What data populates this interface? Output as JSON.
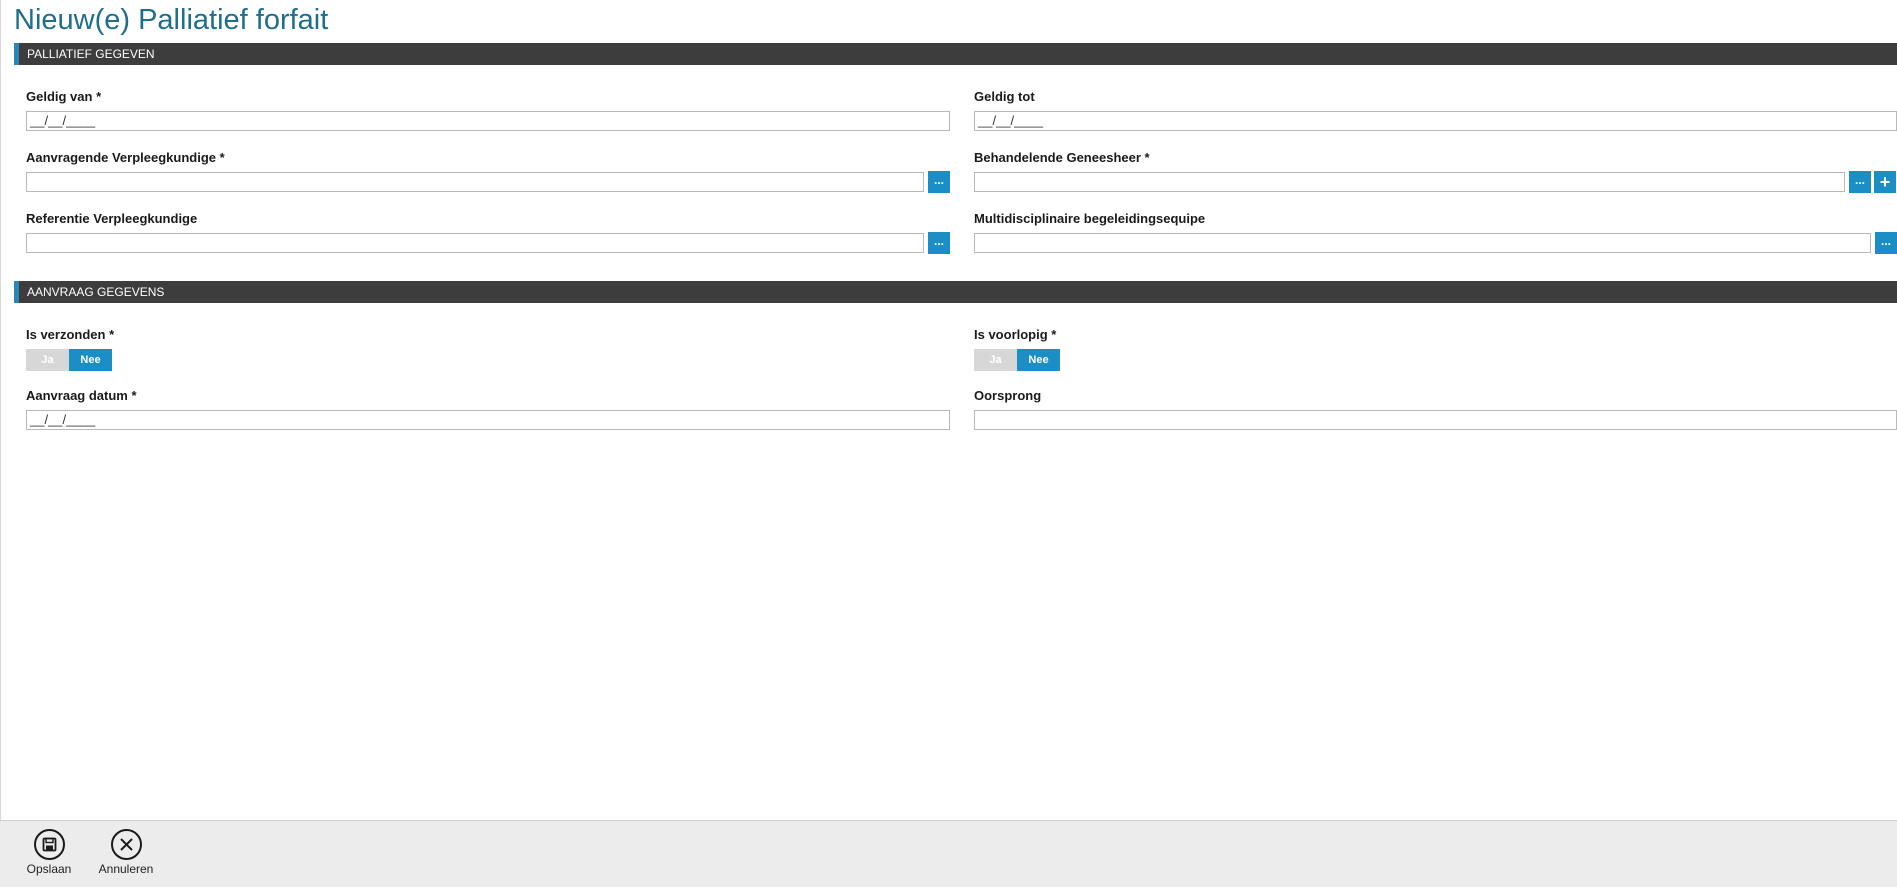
{
  "page": {
    "title": "Nieuw(e) Palliatief forfait"
  },
  "sections": {
    "palliatief": {
      "title": "PALLIATIEF GEGEVEN"
    },
    "aanvraag": {
      "title": "AANVRAAG GEGEVENS"
    }
  },
  "fields": {
    "geldig_van": {
      "label": "Geldig van *",
      "value": "__/__/____"
    },
    "geldig_tot": {
      "label": "Geldig tot",
      "value": "__/__/____"
    },
    "aanvragende_verpleegkundige": {
      "label": "Aanvragende Verpleegkundige *",
      "value": ""
    },
    "behandelende_geneesheer": {
      "label": "Behandelende Geneesheer *",
      "value": ""
    },
    "referentie_verpleegkundige": {
      "label": "Referentie Verpleegkundige",
      "value": ""
    },
    "multidisciplinaire": {
      "label": "Multidisciplinaire begeleidingsequipe",
      "value": ""
    },
    "is_verzonden": {
      "label": "Is verzonden *",
      "option_yes": "Ja",
      "option_no": "Nee",
      "selected": "Nee"
    },
    "is_voorlopig": {
      "label": "Is voorlopig *",
      "option_yes": "Ja",
      "option_no": "Nee",
      "selected": "Nee"
    },
    "aanvraag_datum": {
      "label": "Aanvraag datum *",
      "value": "__/__/____"
    },
    "oorsprong": {
      "label": "Oorsprong",
      "value": ""
    }
  },
  "buttons": {
    "lookup": "...",
    "add": "+"
  },
  "footer": {
    "save": {
      "label": "Opslaan",
      "icon": "save-icon"
    },
    "cancel": {
      "label": "Annuleren",
      "icon": "close-circle-icon"
    }
  },
  "colors": {
    "accent": "#1b8fc5",
    "title": "#1f6e8c",
    "section_bar": "#3d3d3d",
    "toggle_off": "#d7d7d7"
  }
}
